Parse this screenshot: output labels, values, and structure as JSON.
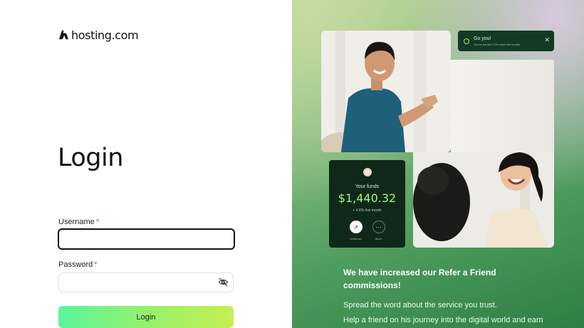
{
  "brand": {
    "name": "hosting.com",
    "logo_icon": "hosting-logo-icon"
  },
  "login": {
    "title": "Login",
    "username_label": "Username",
    "password_label": "Password",
    "required_mark": "*",
    "username_value": "",
    "password_value": "",
    "submit_label": "Login",
    "eye_icon": "eye-off-icon"
  },
  "promo": {
    "toast": {
      "title": "Go you!",
      "subtitle": "You've earned 12% more this month!",
      "close_glyph": "✕"
    },
    "funds_card": {
      "label": "Your funds",
      "value": "$1,440.32",
      "change": "+ 4.6% this month",
      "actions": [
        {
          "label": "Withdraw",
          "glyph": "↗"
        },
        {
          "label": "More",
          "glyph": "⋯"
        }
      ]
    },
    "headline": "We have increased our Refer a Friend commissions!",
    "line1": "Spread the word about the service you trust.",
    "line2": "Help a friend on his journey into the digital world and earn"
  },
  "colors": {
    "accent_gradient_start": "#5af59a",
    "accent_gradient_end": "#c4f055",
    "required": "#e24b3a",
    "dark_card": "#10281a",
    "funds_value": "#a8f07a"
  }
}
